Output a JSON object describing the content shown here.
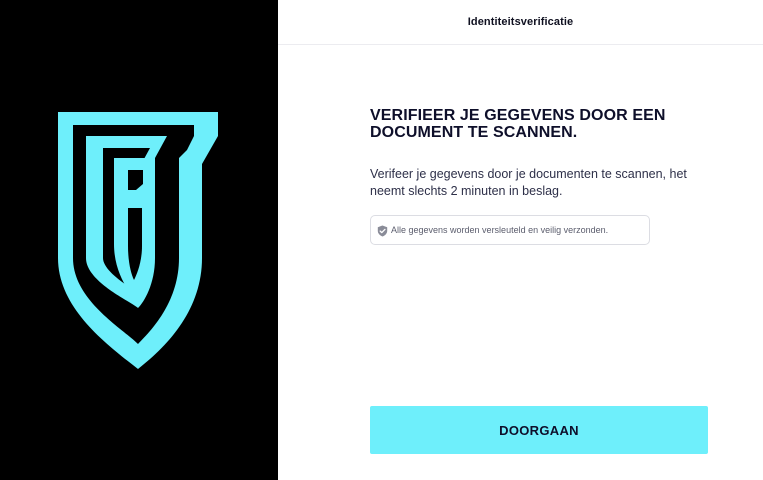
{
  "brand": {
    "logo_icon": "shield-b-logo",
    "logo_color": "#6EEFFB",
    "panel_color": "#000000"
  },
  "header": {
    "title": "Identiteitsverificatie"
  },
  "main": {
    "headline": "VERIFIEER JE GEGEVENS DOOR EEN DOCUMENT TE SCANNEN.",
    "description": "Verifeer je gegevens door je documenten te scannen, het neemt slechts 2 minuten in beslag.",
    "security_notice": {
      "icon": "shield-check-icon",
      "text": "Alle gegevens worden versleuteld en veilig verzonden."
    }
  },
  "actions": {
    "continue_label": "DOORGAAN",
    "continue_color": "#6EEFFB"
  }
}
